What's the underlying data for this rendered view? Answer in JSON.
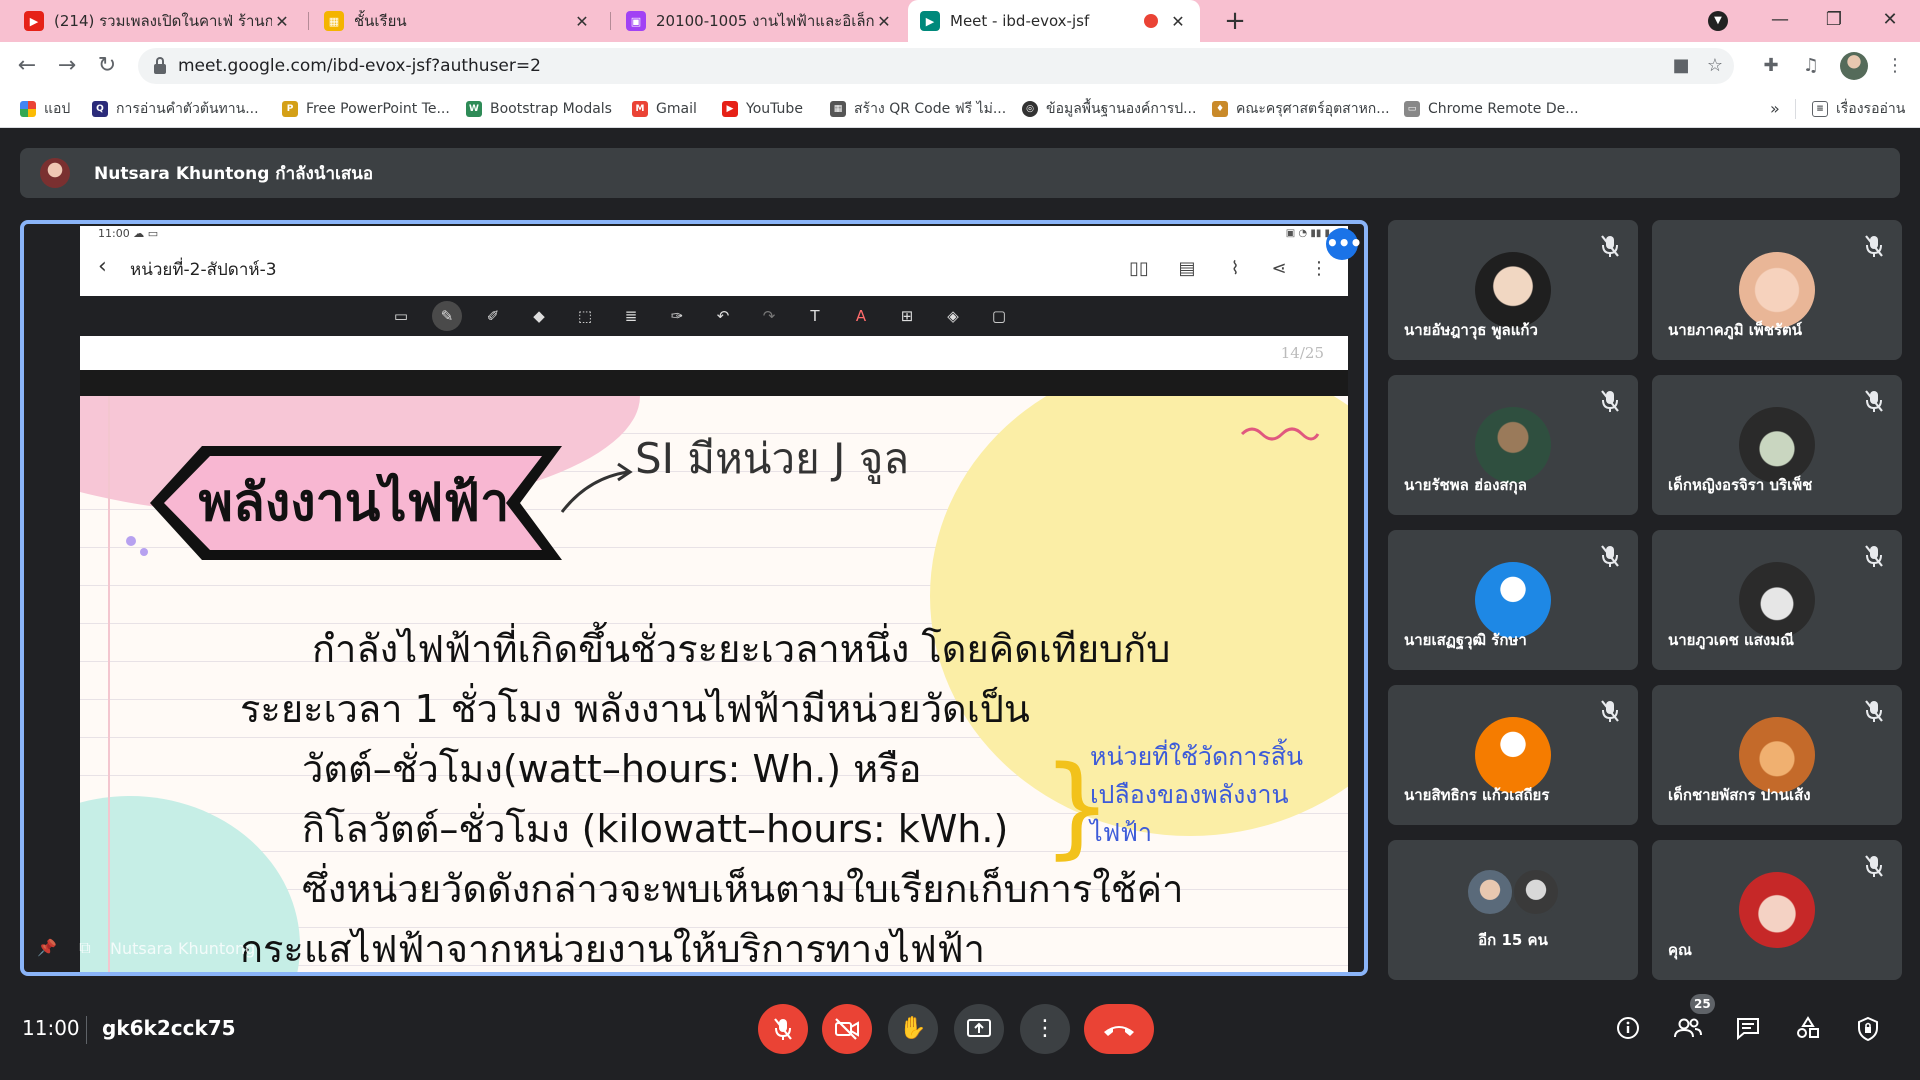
{
  "browser": {
    "tabs": [
      {
        "title": "(214) รวมเพลงเปิดในคาเฟ่ ร้านกาแฟ ",
        "icon": "youtube-icon"
      },
      {
        "title": "ชั้นเรียน",
        "icon": "classroom-icon"
      },
      {
        "title": "20100-1005 งานไฟฟ้าและอิเล็กทรอนิ",
        "icon": "classroom-icon"
      },
      {
        "title": "Meet - ibd-evox-jsf",
        "icon": "meet-icon",
        "active": true,
        "recording": true
      }
    ],
    "new_tab": "+",
    "url": "meet.google.com/ibd-evox-jsf?authuser=2",
    "bookmarks": [
      {
        "label": "แอป",
        "icon": "apps-icon",
        "color": "#ea4335"
      },
      {
        "label": "การอ่านคำตัวต้นทาน...",
        "icon": "q-icon",
        "color": "#2b2b7a"
      },
      {
        "label": "Free PowerPoint Te...",
        "icon": "powerpoint-template-icon",
        "color": "#d4a017"
      },
      {
        "label": "Bootstrap Modals",
        "icon": "w3-icon",
        "color": "#2e8b57"
      },
      {
        "label": "Gmail",
        "icon": "gmail-icon",
        "color": "#ea4335"
      },
      {
        "label": "YouTube",
        "icon": "youtube-icon",
        "color": "#e62117"
      },
      {
        "label": "สร้าง QR Code ฟรี ไม่...",
        "icon": "qr-code-icon",
        "color": "#555555"
      },
      {
        "label": "ข้อมูลพื้นฐานองค์การป...",
        "icon": "globe-icon",
        "color": "#333333"
      },
      {
        "label": "คณะครุศาสตร์อุตสาหก...",
        "icon": "university-icon",
        "color": "#c98a2a"
      },
      {
        "label": "Chrome Remote De...",
        "icon": "remote-desktop-icon",
        "color": "#888888"
      }
    ],
    "bookmarks_more": "»",
    "reading_list": "เรื่องรออ่าน"
  },
  "meet": {
    "presenter_banner": "Nutsara Khuntong กำลังนำเสนอ",
    "presenter_name": "Nutsara Khuntong",
    "time": "11:00",
    "meeting_code": "gk6k2cck75",
    "participants_count": "25",
    "participants": [
      {
        "name": "นายอัษฎาวุธ พูลแก้ว",
        "muted": true,
        "avatar": "photo"
      },
      {
        "name": "นายภาคภูมิ เพ็ชรัตน์",
        "muted": true,
        "avatar": "photo"
      },
      {
        "name": "นายรัชพล ฮ่องสกุล",
        "muted": true,
        "avatar": "photo"
      },
      {
        "name": "เด็กหญิงอรจิรา บริเพ็ช",
        "muted": true,
        "avatar": "photo"
      },
      {
        "name": "นายเสฏฐวุฒิ รักษา",
        "muted": true,
        "avatar": "default-blue"
      },
      {
        "name": "นายภูวเดช แสงมณี",
        "muted": true,
        "avatar": "photo"
      },
      {
        "name": "นายสิทธิกร แก้วเสถียร",
        "muted": true,
        "avatar": "default-orange"
      },
      {
        "name": "เด็กชายพัสกร ปานเส้ง",
        "muted": true,
        "avatar": "photo"
      },
      {
        "name": "อีก 15 คน",
        "muted": false,
        "avatar": "group"
      },
      {
        "name": "คุณ",
        "muted": true,
        "avatar": "photo"
      }
    ]
  },
  "shared_screen": {
    "status_time": "11:00",
    "doc_title": "หน่วยที่-2-สัปดาห์-3",
    "page_indicator": "14/25",
    "slide": {
      "title": "พลังงานไฟฟ้า",
      "si_note": "SI มีหน่วย J จูล",
      "body_lines": [
        "กำลังไฟฟ้าที่เกิดขึ้นชั่วระยะเวลาหนึ่ง โดยคิดเทียบกับ",
        "ระยะเวลา 1 ชั่วโมง พลังงานไฟฟ้ามีหน่วยวัดเป็น",
        "วัตต์–ชั่วโมง(watt–hours: Wh.) หรือ",
        "กิโลวัตต์–ชั่วโมง (kilowatt–hours: kWh.)",
        "ซึ่งหน่วยวัดดังกล่าวจะพบเห็นตามใบเรียกเก็บการใช้ค่า",
        "กระแสไฟฟ้าจากหน่วยงานให้บริการทางไฟฟ้า"
      ],
      "side_note": [
        "หน่วยที่ใช้วัดการสิ้น",
        "เปลืองของพลังงาน",
        "ไฟฟ้า"
      ]
    }
  },
  "colors": {
    "tab_strip": "#f8c0d0",
    "meet_bg": "#202124",
    "tile_bg": "#3c4043",
    "danger": "#ea4335",
    "presenter_border": "#8ab4f8",
    "note_blue": "#3d5bd9"
  }
}
